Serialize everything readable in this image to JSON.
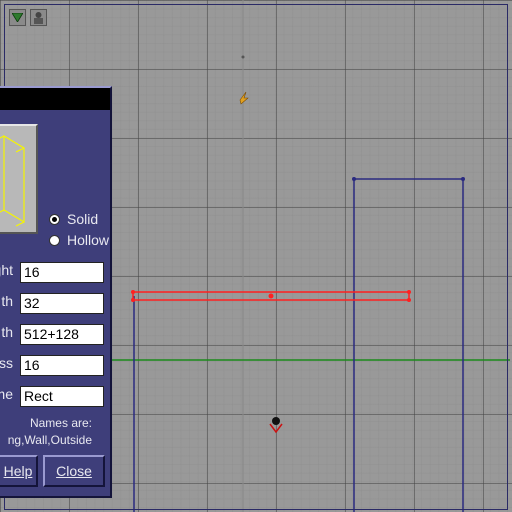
{
  "toolbar": {
    "icons": [
      "dropdown-arrow-icon",
      "builder-brush-icon"
    ]
  },
  "dialog": {
    "shape_options": [
      {
        "label": "Solid",
        "checked": true
      },
      {
        "label": "Hollow",
        "checked": false
      }
    ],
    "fields": [
      {
        "label": "ght",
        "value": "16"
      },
      {
        "label": "th",
        "value": "32"
      },
      {
        "label": "th",
        "value": "512+128"
      },
      {
        "label": "ss",
        "value": "16"
      },
      {
        "label": "me",
        "value": "Rect"
      }
    ],
    "names_text_line1": "Names are:",
    "names_text_line2": "ng,Wall,Outside",
    "help_label": "Help",
    "close_label": "Close"
  },
  "colors": {
    "selected_brush": "#ff2020",
    "brush_outline": "#2a2a80",
    "horizon_line": "#1a8a1a",
    "dialog_bg": "#3e3e7a",
    "preview_wire": "#f5f500"
  }
}
